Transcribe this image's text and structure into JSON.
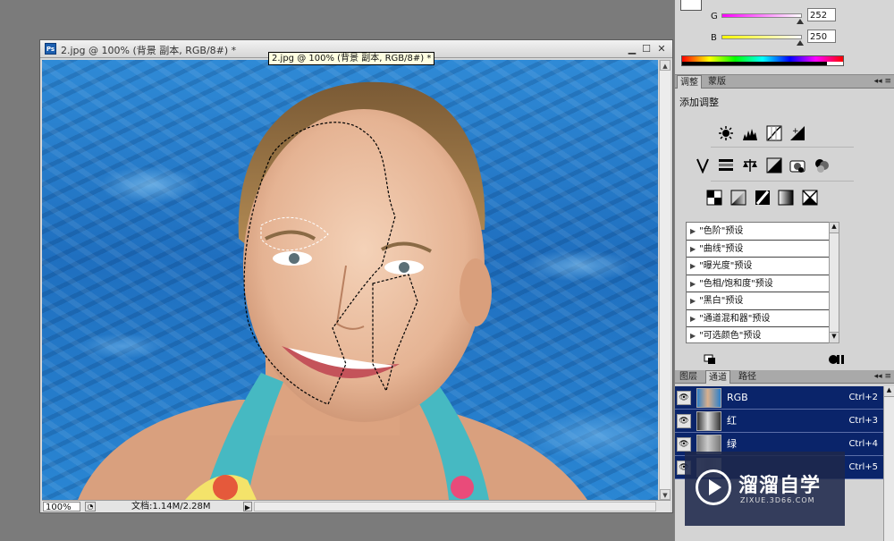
{
  "document": {
    "title": "2.jpg @ 100% (背景 副本, RGB/8#) *",
    "tooltip": "2.jpg @ 100% (背景 副本, RGB/8#) *",
    "zoom": "100%",
    "doc_info": "文档:1.14M/2.28M",
    "window_buttons": {
      "minimize": "▁",
      "maximize": "☐",
      "close": "✕"
    }
  },
  "color_panel": {
    "channels": [
      {
        "label": "G",
        "value": "252",
        "gradient": [
          "#ff00ff",
          "#ffffff"
        ]
      },
      {
        "label": "B",
        "value": "250",
        "gradient": [
          "#ffff00",
          "#ffffff"
        ]
      }
    ]
  },
  "adjustments": {
    "tabs": [
      "调整",
      "蒙版"
    ],
    "active_tab": "调整",
    "title": "添加调整",
    "presets": [
      "\"色阶\"预设",
      "\"曲线\"预设",
      "\"曝光度\"预设",
      "\"色相/饱和度\"预设",
      "\"黑白\"预设",
      "\"通道混和器\"预设",
      "\"可选颜色\"预设"
    ],
    "icons_row1": [
      "brightness-icon",
      "levels-icon",
      "curves-icon",
      "exposure-icon"
    ],
    "icons_row2": [
      "vibrance-icon",
      "hue-saturation-icon",
      "color-balance-icon",
      "black-white-icon",
      "photo-filter-icon",
      "channel-mixer-icon"
    ],
    "icons_row3": [
      "invert-icon",
      "posterize-icon",
      "threshold-icon",
      "gradient-map-icon",
      "selective-color-icon"
    ]
  },
  "channels_panel": {
    "tabs": [
      "图层",
      "通道",
      "路径"
    ],
    "active_tab": "通道",
    "rows": [
      {
        "name": "RGB",
        "shortcut": "Ctrl+2"
      },
      {
        "name": "红",
        "shortcut": "Ctrl+3"
      },
      {
        "name": "绿",
        "shortcut": "Ctrl+4"
      },
      {
        "name": "",
        "shortcut": "Ctrl+5"
      }
    ]
  },
  "watermark": {
    "brand": "溜溜自学",
    "url": "ZIXUE.3D66.COM"
  },
  "colors": {
    "selection_row": "#0a246a",
    "panel_bg": "#d4d4d4",
    "workspace": "#7b7b7b"
  }
}
